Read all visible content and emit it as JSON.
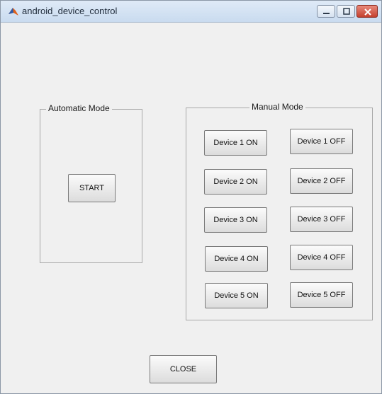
{
  "window": {
    "title": "android_device_control"
  },
  "automatic": {
    "title": "Automatic Mode",
    "start": "START"
  },
  "manual": {
    "title": "Manual Mode",
    "on": [
      "Device 1 ON",
      "Device 2 ON",
      "Device 3 ON",
      "Device 4 ON",
      "Device 5 ON"
    ],
    "off": [
      "Device 1 OFF",
      "Device 2 OFF",
      "Device 3 OFF",
      "Device 4 OFF",
      "Device 5 OFF"
    ]
  },
  "close_label": "CLOSE",
  "colors": {
    "titlebar": "#c9dbef",
    "close_button": "#c4402e",
    "background": "#f0f0f0"
  }
}
